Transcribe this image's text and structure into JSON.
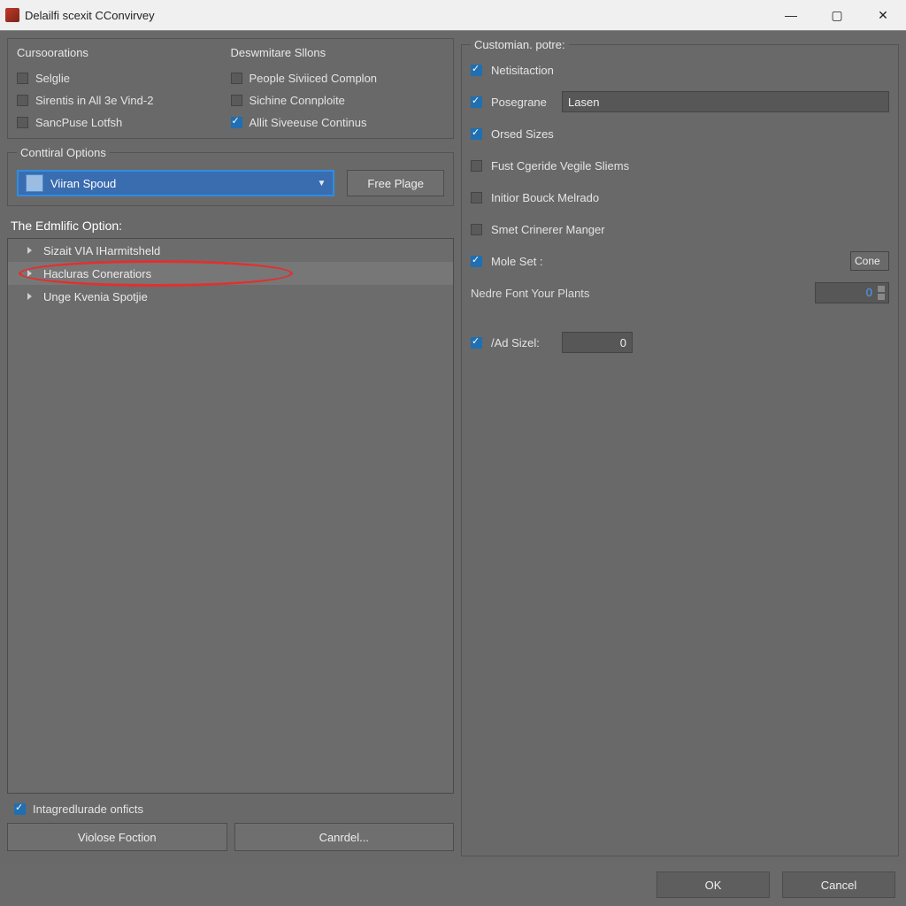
{
  "window": {
    "title": "Delailfi scexit CConvirvey"
  },
  "left": {
    "group1": {
      "title_a": "Cursoorations",
      "title_b": "Deswmitare Sllons",
      "col_a": [
        {
          "label": "Selglie",
          "checked": false
        },
        {
          "label": "Sirentis in All 3e Vind-2",
          "checked": false
        },
        {
          "label": "SancPuse Lotfsh",
          "checked": false
        }
      ],
      "col_b": [
        {
          "label": "People Siviiced Complon",
          "checked": false
        },
        {
          "label": "Sichine Connploite",
          "checked": false
        },
        {
          "label": "Allit Siveeuse Continus",
          "checked": true
        }
      ]
    },
    "group2": {
      "title": "Conttiral Options",
      "dropdown_value": "Viiran Spoud",
      "button_label": "Free Plage"
    },
    "option_title": "The Edmlific Option:",
    "tree": [
      {
        "label": "Sizait VIA IHarmitsheld",
        "selected": false
      },
      {
        "label": "Hacluras Coneratiors",
        "selected": true,
        "highlighted": true
      },
      {
        "label": "Unge Kvenia Spotjie",
        "selected": false
      }
    ],
    "integrate_check": {
      "label": "Intagredlurade onficts",
      "checked": true
    },
    "bottom_buttons": [
      "Violose Foction",
      "Canrdel..."
    ]
  },
  "right": {
    "group_title": "Customian. potre:",
    "checks": [
      {
        "label": "Netisitaction",
        "checked": true
      },
      {
        "label": "Posegrane",
        "checked": true,
        "has_input": true,
        "input_value": "Lasen"
      },
      {
        "label": "Orsed Sizes",
        "checked": true
      },
      {
        "label": "Fust Cgeride Vegile Sliems",
        "checked": false
      },
      {
        "label": "Initior Bouck Melrado",
        "checked": false
      },
      {
        "label": "Smet Crinerer Manger",
        "checked": false
      }
    ],
    "mole_set": {
      "label": "Mole Set :",
      "checked": true,
      "value": "Cone"
    },
    "nedre_row": {
      "label": "Nedre Font Your Plants",
      "value": "0"
    },
    "ad_size": {
      "label": "/Ad Sizel:",
      "checked": true,
      "value": "0"
    }
  },
  "footer": {
    "ok": "OK",
    "cancel": "Cancel"
  }
}
